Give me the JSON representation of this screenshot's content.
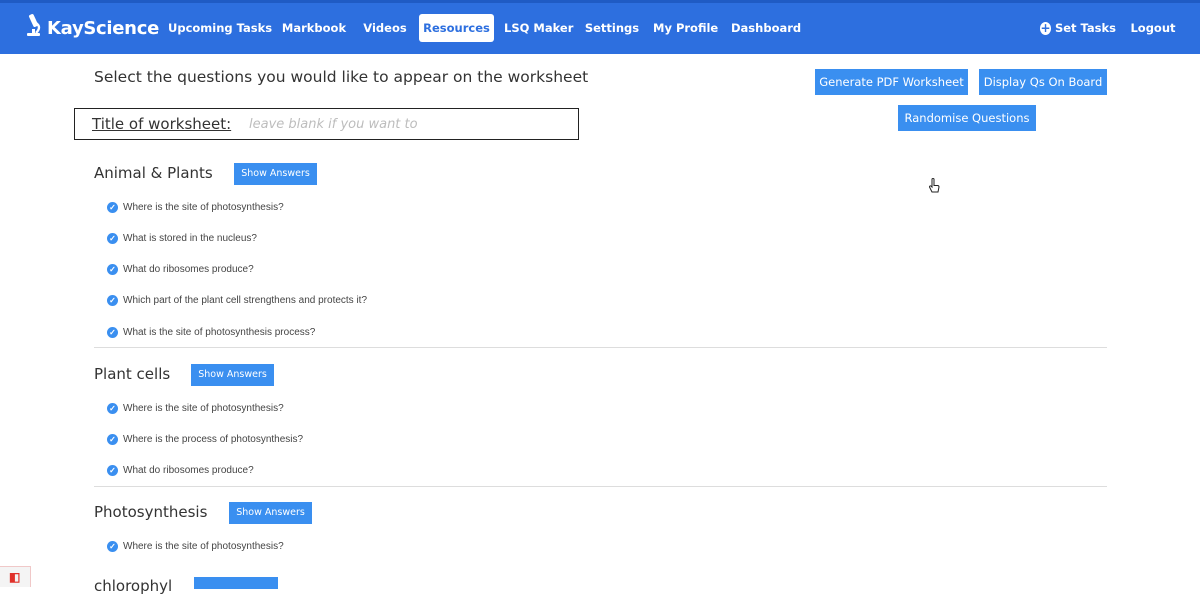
{
  "nav": {
    "brand": "KayScience",
    "items": [
      "Upcoming Tasks",
      "Markbook",
      "Videos",
      "Resources",
      "LSQ Maker",
      "Settings",
      "My Profile",
      "Dashboard"
    ],
    "active": "Resources",
    "set_tasks": "Set Tasks",
    "logout": "Logout"
  },
  "page": {
    "heading": "Select the questions you would like to appear on the worksheet",
    "title_label": "Title of worksheet:",
    "title_placeholder": "leave blank if you want to"
  },
  "actions": {
    "generate_pdf": "Generate PDF Worksheet",
    "display_board": "Display Qs On Board",
    "randomise": "Randomise Questions"
  },
  "sections": [
    {
      "title": "Animal & Plants",
      "show_answers": "Show Answers",
      "questions": [
        "Where is the site of photosynthesis?",
        "What is stored in the nucleus?",
        "What do ribosomes produce?",
        "Which part of the plant cell strengthens and protects it?",
        "What is the site of photosynthesis process?"
      ]
    },
    {
      "title": "Plant cells",
      "show_answers": "Show Answers",
      "questions": [
        "Where is the site of photosynthesis?",
        "Where is the process of photosynthesis?",
        "What do ribosomes produce?"
      ]
    },
    {
      "title": "Photosynthesis",
      "show_answers": "Show Answers",
      "questions": [
        "Where is the site of photosynthesis?"
      ]
    },
    {
      "title": "chlorophyl"
    }
  ],
  "colors": {
    "nav": "#2d6fdf",
    "button": "#3a8ff0",
    "check": "#3a8ff0"
  },
  "icons": {
    "brand": "microscope-icon",
    "set_tasks": "plus-circle-icon",
    "question": "check-circle-icon",
    "cursor": "hand-pointer-icon",
    "corner": "laravel-logo-icon"
  }
}
